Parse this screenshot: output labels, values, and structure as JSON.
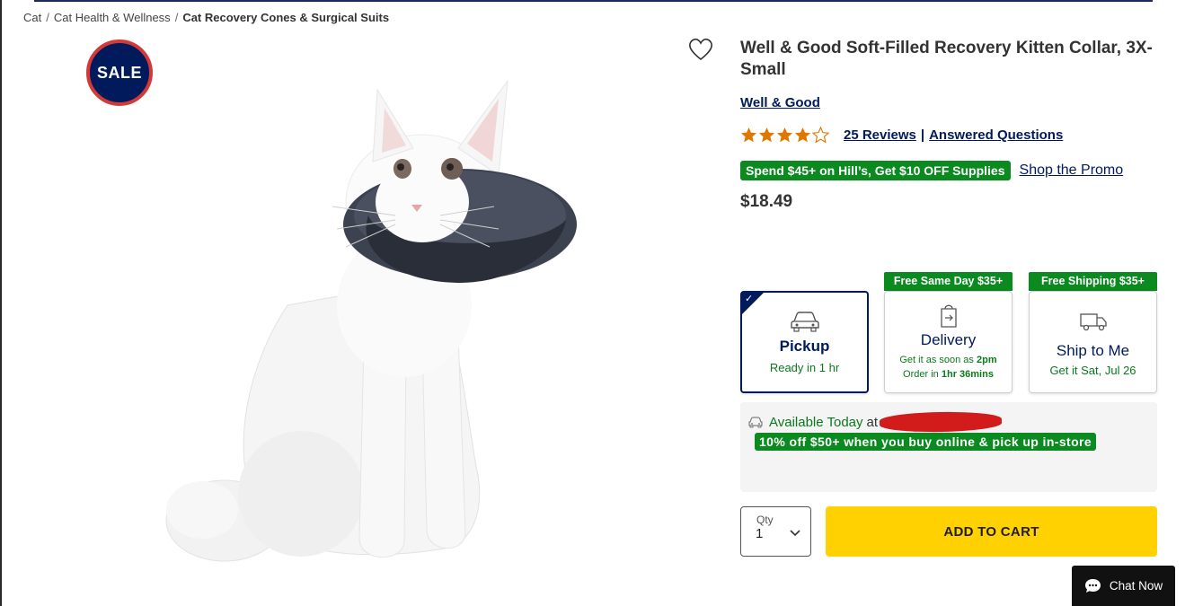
{
  "breadcrumb": {
    "items": [
      "Cat",
      "Cat Health & Wellness"
    ],
    "current": "Cat Recovery Cones & Surgical Suits",
    "separator": "/"
  },
  "badge": {
    "label": "SALE"
  },
  "product": {
    "title": "Well & Good Soft-Filled Recovery Kitten Collar, 3X-Small",
    "brand": "Well & Good",
    "rating": 4,
    "reviews_label": "25 Reviews",
    "separator": "|",
    "qa_label": "Answered Questions",
    "promo_tag": "Spend $45+ on Hill’s, Get $10 OFF Supplies",
    "promo_link": "Shop the Promo",
    "price": "$18.49"
  },
  "fulfillment": {
    "pickup": {
      "name": "Pickup",
      "sub": "Ready in 1 hr",
      "check": "✓"
    },
    "delivery": {
      "ribbon": "Free Same Day $35+",
      "name": "Delivery",
      "line1_prefix": "Get it as soon as",
      "line1_time": "2pm",
      "line2_prefix": "Order in",
      "line2_time": "1hr 36mins"
    },
    "ship": {
      "ribbon": "Free Shipping $35+",
      "name": "Ship to Me",
      "sub": "Get it Sat, Jul 26"
    }
  },
  "availability": {
    "text": "Available Today",
    "at": "at",
    "promo": "10% off $50+ when you buy online & pick up in-store"
  },
  "cart": {
    "qty_label": "Qty",
    "qty_value": "1",
    "add_label": "ADD TO CART"
  },
  "chat": {
    "label": "Chat Now"
  },
  "colors": {
    "navy": "#001a5b",
    "green": "#0a8a1f",
    "yellow": "#ffd100",
    "star": "#e07800",
    "sale_ring": "#d23a3a"
  }
}
